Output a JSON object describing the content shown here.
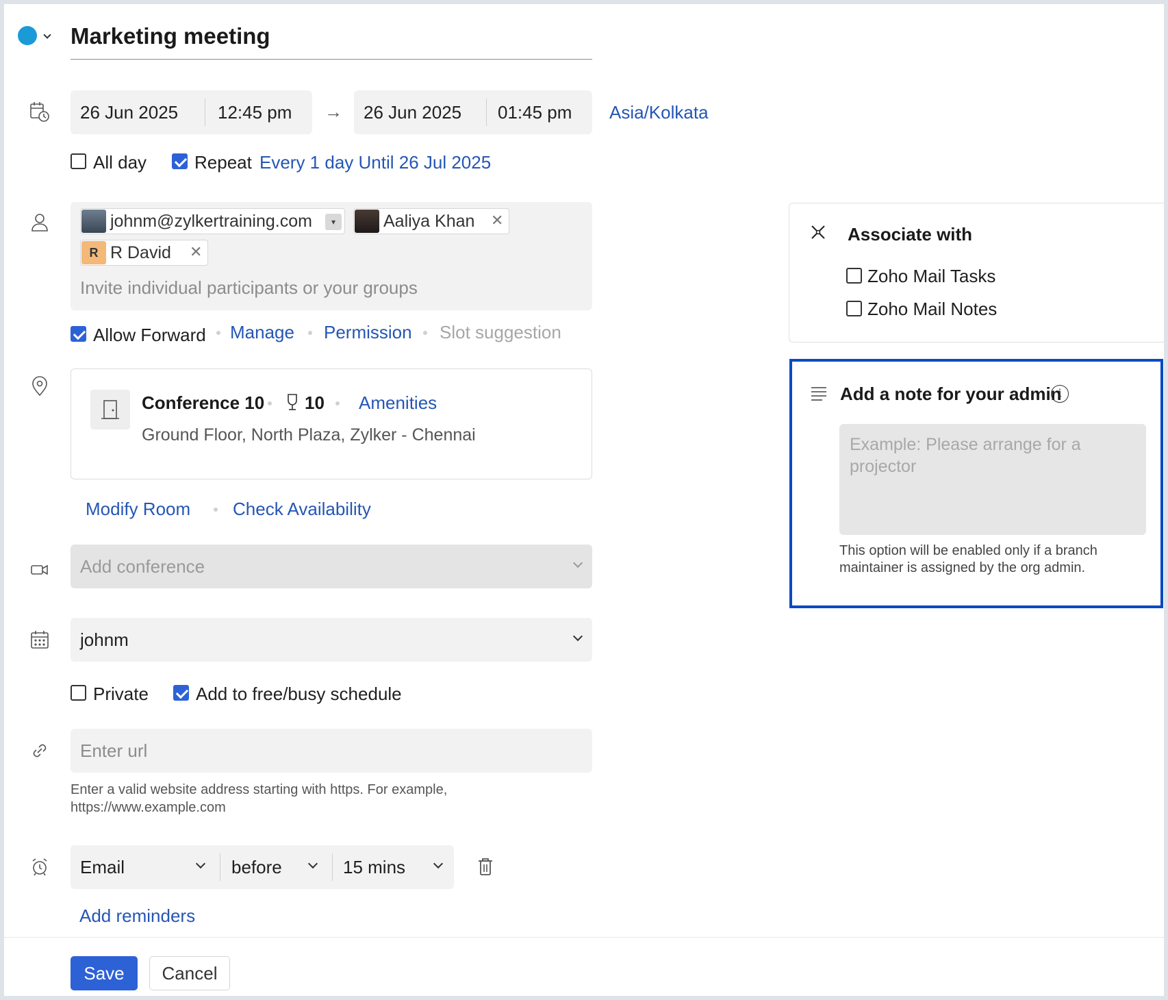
{
  "event": {
    "title": "Marketing meeting",
    "color": "#1a9bd7"
  },
  "datetime": {
    "start_date": "26 Jun 2025",
    "start_time": "12:45 pm",
    "end_date": "26 Jun 2025",
    "end_time": "01:45 pm",
    "timezone": "Asia/Kolkata",
    "all_day_label": "All day",
    "all_day_checked": false,
    "repeat_label": "Repeat",
    "repeat_checked": true,
    "repeat_rule": "Every 1 day Until 26 Jul 2025"
  },
  "participants": {
    "chips": [
      {
        "name": "johnm@zylkertraining.com",
        "avatar": "photo"
      },
      {
        "name": "Aaliya Khan",
        "avatar": "photo"
      },
      {
        "name": "R David",
        "avatar_letter": "R",
        "avatar_color": "#f4b879"
      }
    ],
    "placeholder": "Invite individual participants or your groups",
    "allow_forward_label": "Allow Forward",
    "allow_forward_checked": true,
    "manage_label": "Manage",
    "permission_label": "Permission",
    "slot_suggestion_label": "Slot suggestion"
  },
  "location": {
    "room_name": "Conference 10",
    "capacity": "10",
    "amenities_label": "Amenities",
    "address": "Ground Floor, North Plaza, Zylker - Chennai",
    "modify_room_label": "Modify Room",
    "check_availability_label": "Check Availability"
  },
  "conference": {
    "placeholder": "Add conference"
  },
  "calendar": {
    "selected": "johnm",
    "private_label": "Private",
    "private_checked": false,
    "freebusy_label": "Add to free/busy schedule",
    "freebusy_checked": true
  },
  "url": {
    "placeholder": "Enter url",
    "hint_line1": "Enter a valid website address starting with https. For example,",
    "hint_line2": "https://www.example.com"
  },
  "reminder": {
    "type": "Email",
    "when": "before",
    "duration": "15 mins",
    "add_label": "Add reminders"
  },
  "associate": {
    "title": "Associate with",
    "options": [
      {
        "label": "Zoho Mail Tasks",
        "checked": false
      },
      {
        "label": "Zoho Mail Notes",
        "checked": false
      }
    ]
  },
  "admin_note": {
    "title": "Add a note for your admin",
    "placeholder": "Example: Please arrange for a projector",
    "help_line1": "This option will be enabled only if a branch",
    "help_line2": "maintainer is assigned by the org admin."
  },
  "actions": {
    "save_label": "Save",
    "cancel_label": "Cancel"
  },
  "colors": {
    "link": "#2456b5",
    "primary": "#2d62d6",
    "highlight_border": "#0a49c2"
  }
}
